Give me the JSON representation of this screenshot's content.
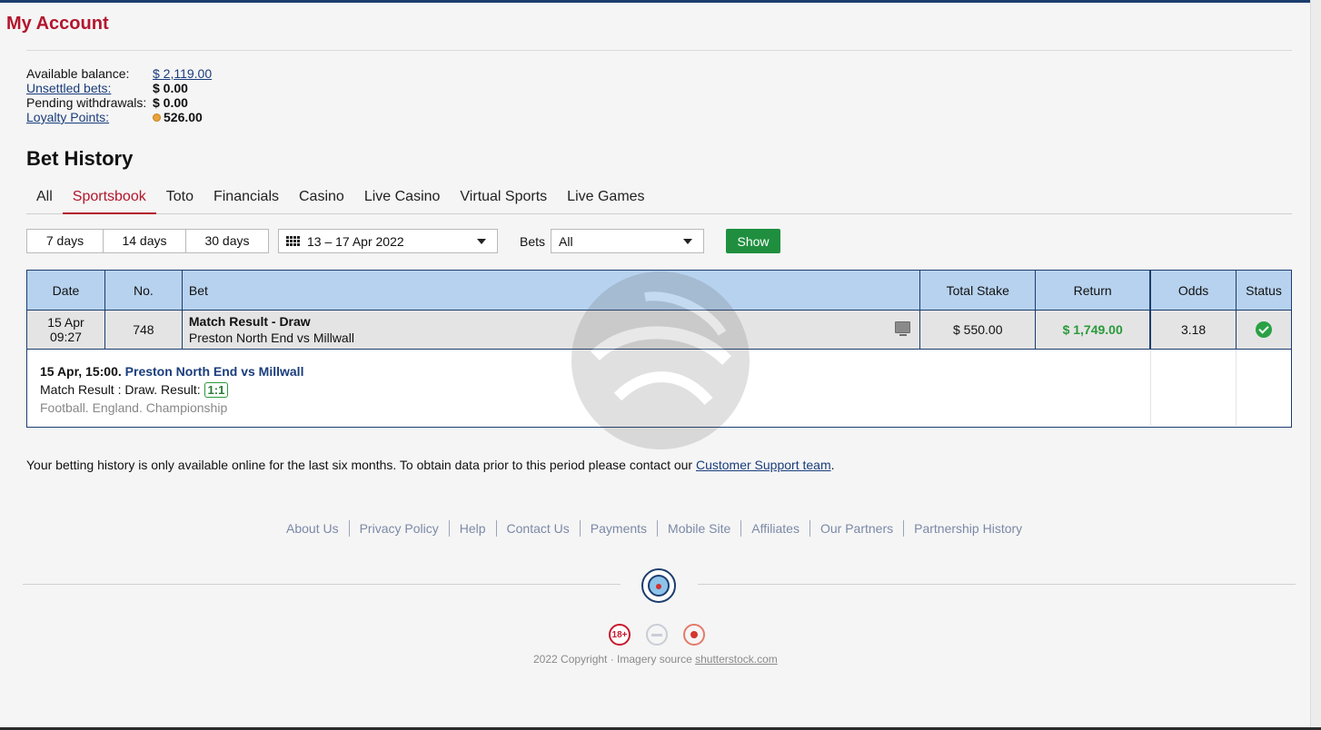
{
  "page": {
    "title": "My Account"
  },
  "balance": {
    "available_label": "Available balance:",
    "available_value": "$ 2,119.00",
    "unsettled_label": "Unsettled bets:",
    "unsettled_value": "$ 0.00",
    "pending_label": "Pending withdrawals:",
    "pending_value": "$ 0.00",
    "loyalty_label": "Loyalty Points:",
    "loyalty_value": "526.00"
  },
  "section": {
    "title": "Bet History"
  },
  "tabs": [
    {
      "label": "All"
    },
    {
      "label": "Sportsbook",
      "active": true
    },
    {
      "label": "Toto"
    },
    {
      "label": "Financials"
    },
    {
      "label": "Casino"
    },
    {
      "label": "Live Casino"
    },
    {
      "label": "Virtual Sports"
    },
    {
      "label": "Live Games"
    }
  ],
  "filters": {
    "periods": [
      "7 days",
      "14 days",
      "30 days"
    ],
    "date_range": "13 – 17 Apr 2022",
    "bets_label": "Bets",
    "bets_value": "All",
    "show_label": "Show"
  },
  "table": {
    "headers": [
      "Date",
      "No.",
      "Bet",
      "Total Stake",
      "Return",
      "Odds",
      "Status"
    ],
    "rows": [
      {
        "date": "15 Apr",
        "time": "09:27",
        "no": "748",
        "bet_title": "Match Result - Draw",
        "bet_event": "Preston North End vs Millwall",
        "stake": "$ 550.00",
        "return": "$ 1,749.00",
        "odds": "3.18"
      }
    ],
    "detail": {
      "when": "15 Apr, 15:00.",
      "event": "Preston North End vs Millwall",
      "result_text": "Match Result : Draw. Result:",
      "score": "1:1",
      "category": "Football. England. Championship"
    }
  },
  "note": {
    "text": "Your betting history is only available online for the last six months. To obtain data prior to this period please contact our",
    "link": "Customer Support team",
    "end": "."
  },
  "footer": {
    "links": [
      "About Us",
      "Privacy Policy",
      "Help",
      "Contact Us",
      "Payments",
      "Mobile Site",
      "Affiliates",
      "Our Partners",
      "Partnership History"
    ],
    "badge_18": "18+",
    "copyright": "2022 Copyright · Imagery source",
    "copyright_link": "shutterstock.com"
  },
  "colors": {
    "brand_red": "#b3162c",
    "navy": "#1c3d6e",
    "header_blue": "#b7d2ee",
    "green": "#1f8f3f"
  },
  "icons": [
    "calendar-icon",
    "caret-down-icon",
    "tv-icon",
    "check-circle-icon",
    "coin-icon",
    "club-crest-icon",
    "age-18-icon",
    "responsible-gaming-icon",
    "gamcare-icon"
  ]
}
